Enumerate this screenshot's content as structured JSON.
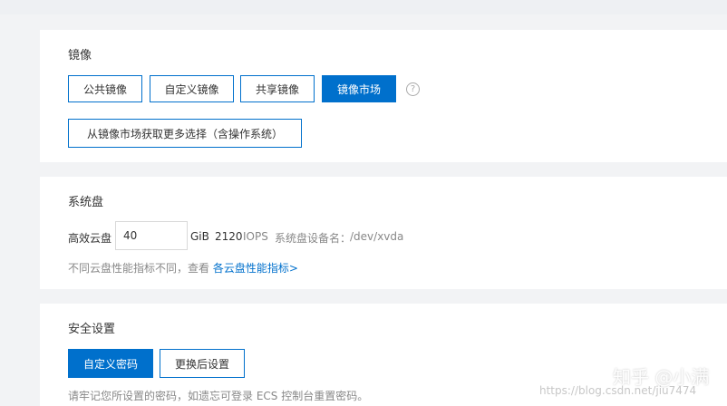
{
  "image_section": {
    "title": "镜像",
    "tabs": [
      "公共镜像",
      "自定义镜像",
      "共享镜像",
      "镜像市场"
    ],
    "active_tab": "镜像市场",
    "help_icon": "?",
    "market_button": "从镜像市场获取更多选择（含操作系统）"
  },
  "system_disk": {
    "title": "系统盘",
    "disk_type": "高效云盘",
    "size_value": "40",
    "unit": "GiB",
    "iops_value": "2120",
    "iops_label": "IOPS",
    "device_label": "系统盘设备名：",
    "device_value": "/dev/xvda",
    "hint_text": "不同云盘性能指标不同，查看",
    "hint_link": "各云盘性能指标>"
  },
  "security": {
    "title": "安全设置",
    "buttons": [
      "自定义密码",
      "更换后设置"
    ],
    "active_button": "自定义密码",
    "note": "请牢记您所设置的密码，如遗忘可登录 ECS 控制台重置密码。"
  },
  "watermarks": {
    "zhihu": "知乎 @小满",
    "blog": "https://blog.csdn.net/jiu7474"
  },
  "colors": {
    "accent": "#0070cc",
    "background": "#f2f3f5"
  }
}
